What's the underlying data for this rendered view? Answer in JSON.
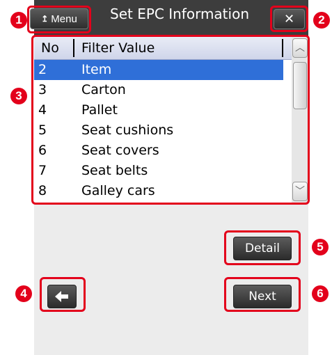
{
  "titlebar": {
    "menu_label": "Menu",
    "title": "Set EPC Information",
    "close_label": "✕"
  },
  "list": {
    "headers": {
      "no": "No",
      "filter": "Filter Value"
    },
    "rows": [
      {
        "no": "2",
        "value": "Item",
        "selected": true
      },
      {
        "no": "3",
        "value": "Carton"
      },
      {
        "no": "4",
        "value": "Pallet"
      },
      {
        "no": "5",
        "value": "Seat cushions"
      },
      {
        "no": "6",
        "value": "Seat covers"
      },
      {
        "no": "7",
        "value": "Seat belts"
      },
      {
        "no": "8",
        "value": "Galley cars"
      }
    ]
  },
  "buttons": {
    "detail": "Detail",
    "next": "Next",
    "back_icon": "back-arrow-icon"
  },
  "callouts": [
    "1",
    "2",
    "3",
    "4",
    "5",
    "6"
  ],
  "colors": {
    "accent": "#e3001b",
    "selection": "#2f6fd8",
    "titlebar": "#3d3d3d"
  }
}
